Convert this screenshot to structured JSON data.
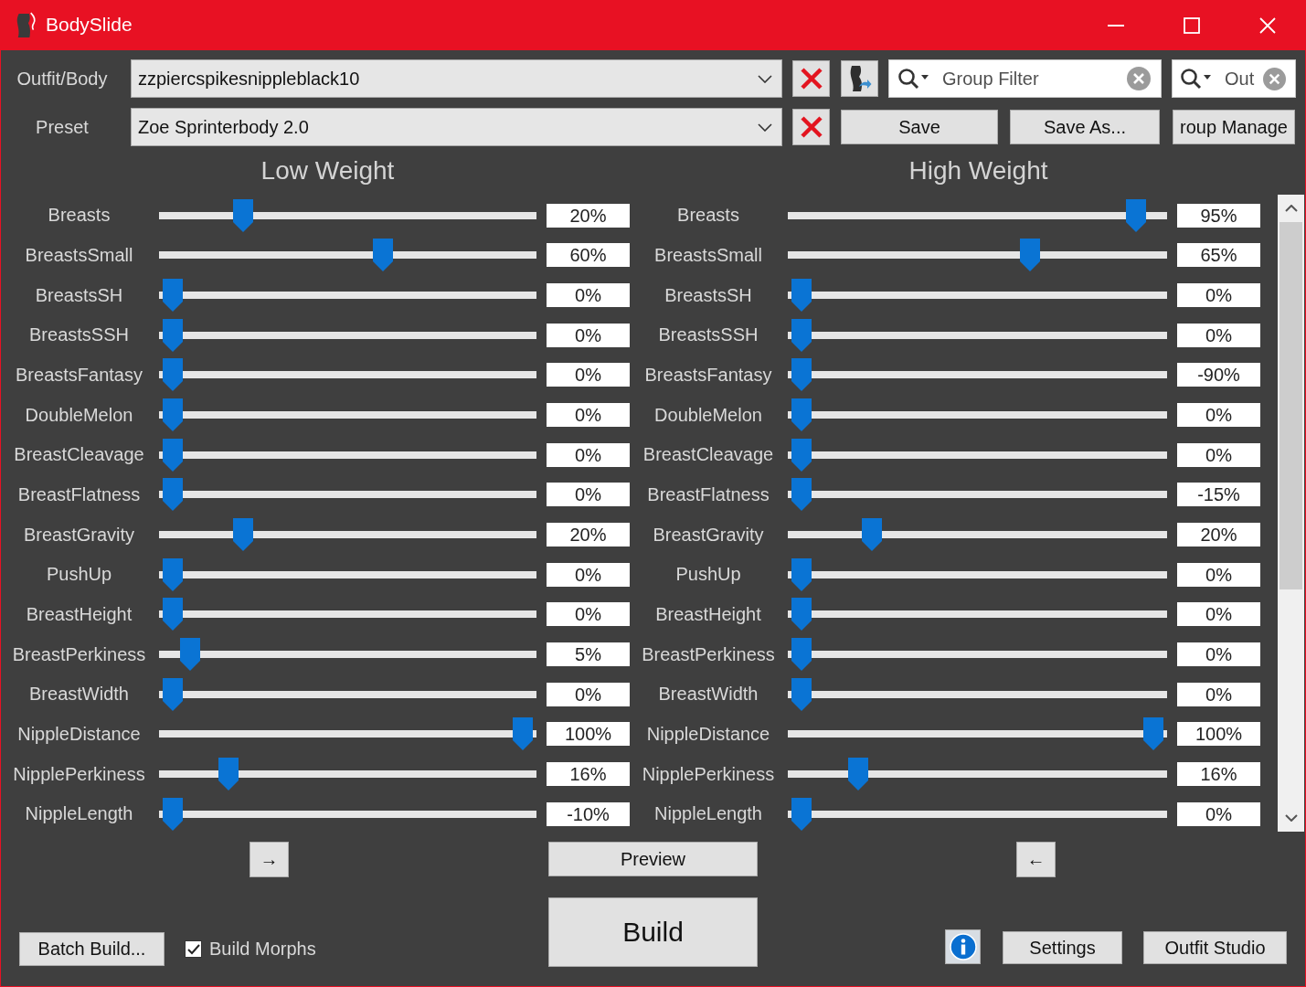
{
  "window": {
    "title": "BodySlide"
  },
  "outfit": {
    "label": "Outfit/Body",
    "value": "zzpiercspikesnippleblack10"
  },
  "group_filter": {
    "placeholder": "Group Filter"
  },
  "outfit_filter": {
    "placeholder": "Out"
  },
  "preset": {
    "label": "Preset",
    "value": "Zoe Sprinterbody 2.0"
  },
  "preset_buttons": [
    "Save",
    "Save As...",
    "roup Manage"
  ],
  "panels": [
    {
      "title": "Low Weight",
      "sliders": [
        {
          "label": "Breasts",
          "value": "20%",
          "level": 0.2
        },
        {
          "label": "BreastsSmall",
          "value": "60%",
          "level": 0.6
        },
        {
          "label": "BreastsSH",
          "value": "0%",
          "level": 0
        },
        {
          "label": "BreastsSSH",
          "value": "0%",
          "level": 0
        },
        {
          "label": "BreastsFantasy",
          "value": "0%",
          "level": 0
        },
        {
          "label": "DoubleMelon",
          "value": "0%",
          "level": 0
        },
        {
          "label": "BreastCleavage",
          "value": "0%",
          "level": 0
        },
        {
          "label": "BreastFlatness",
          "value": "0%",
          "level": 0
        },
        {
          "label": "BreastGravity",
          "value": "20%",
          "level": 0.2
        },
        {
          "label": "PushUp",
          "value": "0%",
          "level": 0
        },
        {
          "label": "BreastHeight",
          "value": "0%",
          "level": 0
        },
        {
          "label": "BreastPerkiness",
          "value": "5%",
          "level": 0.05
        },
        {
          "label": "BreastWidth",
          "value": "0%",
          "level": 0
        },
        {
          "label": "NippleDistance",
          "value": "100%",
          "level": 1
        },
        {
          "label": "NipplePerkiness",
          "value": "16%",
          "level": 0.16
        },
        {
          "label": "NippleLength",
          "value": "-10%",
          "level": 0
        }
      ]
    },
    {
      "title": "High Weight",
      "sliders": [
        {
          "label": "Breasts",
          "value": "95%",
          "level": 0.95
        },
        {
          "label": "BreastsSmall",
          "value": "65%",
          "level": 0.65
        },
        {
          "label": "BreastsSH",
          "value": "0%",
          "level": 0
        },
        {
          "label": "BreastsSSH",
          "value": "0%",
          "level": 0
        },
        {
          "label": "BreastsFantasy",
          "value": "-90%",
          "level": 0
        },
        {
          "label": "DoubleMelon",
          "value": "0%",
          "level": 0
        },
        {
          "label": "BreastCleavage",
          "value": "0%",
          "level": 0
        },
        {
          "label": "BreastFlatness",
          "value": "-15%",
          "level": 0
        },
        {
          "label": "BreastGravity",
          "value": "20%",
          "level": 0.2
        },
        {
          "label": "PushUp",
          "value": "0%",
          "level": 0
        },
        {
          "label": "BreastHeight",
          "value": "0%",
          "level": 0
        },
        {
          "label": "BreastPerkiness",
          "value": "0%",
          "level": 0
        },
        {
          "label": "BreastWidth",
          "value": "0%",
          "level": 0
        },
        {
          "label": "NippleDistance",
          "value": "100%",
          "level": 1
        },
        {
          "label": "NipplePerkiness",
          "value": "16%",
          "level": 0.16
        },
        {
          "label": "NippleLength",
          "value": "0%",
          "level": 0
        }
      ]
    }
  ],
  "bottom": {
    "copy_right": "→",
    "preview": "Preview",
    "copy_left": "←",
    "batch_build": "Batch Build...",
    "build_morphs": {
      "label": "Build Morphs",
      "checked": true
    },
    "build": "Build",
    "settings": "Settings",
    "outfit_studio": "Outfit Studio"
  }
}
